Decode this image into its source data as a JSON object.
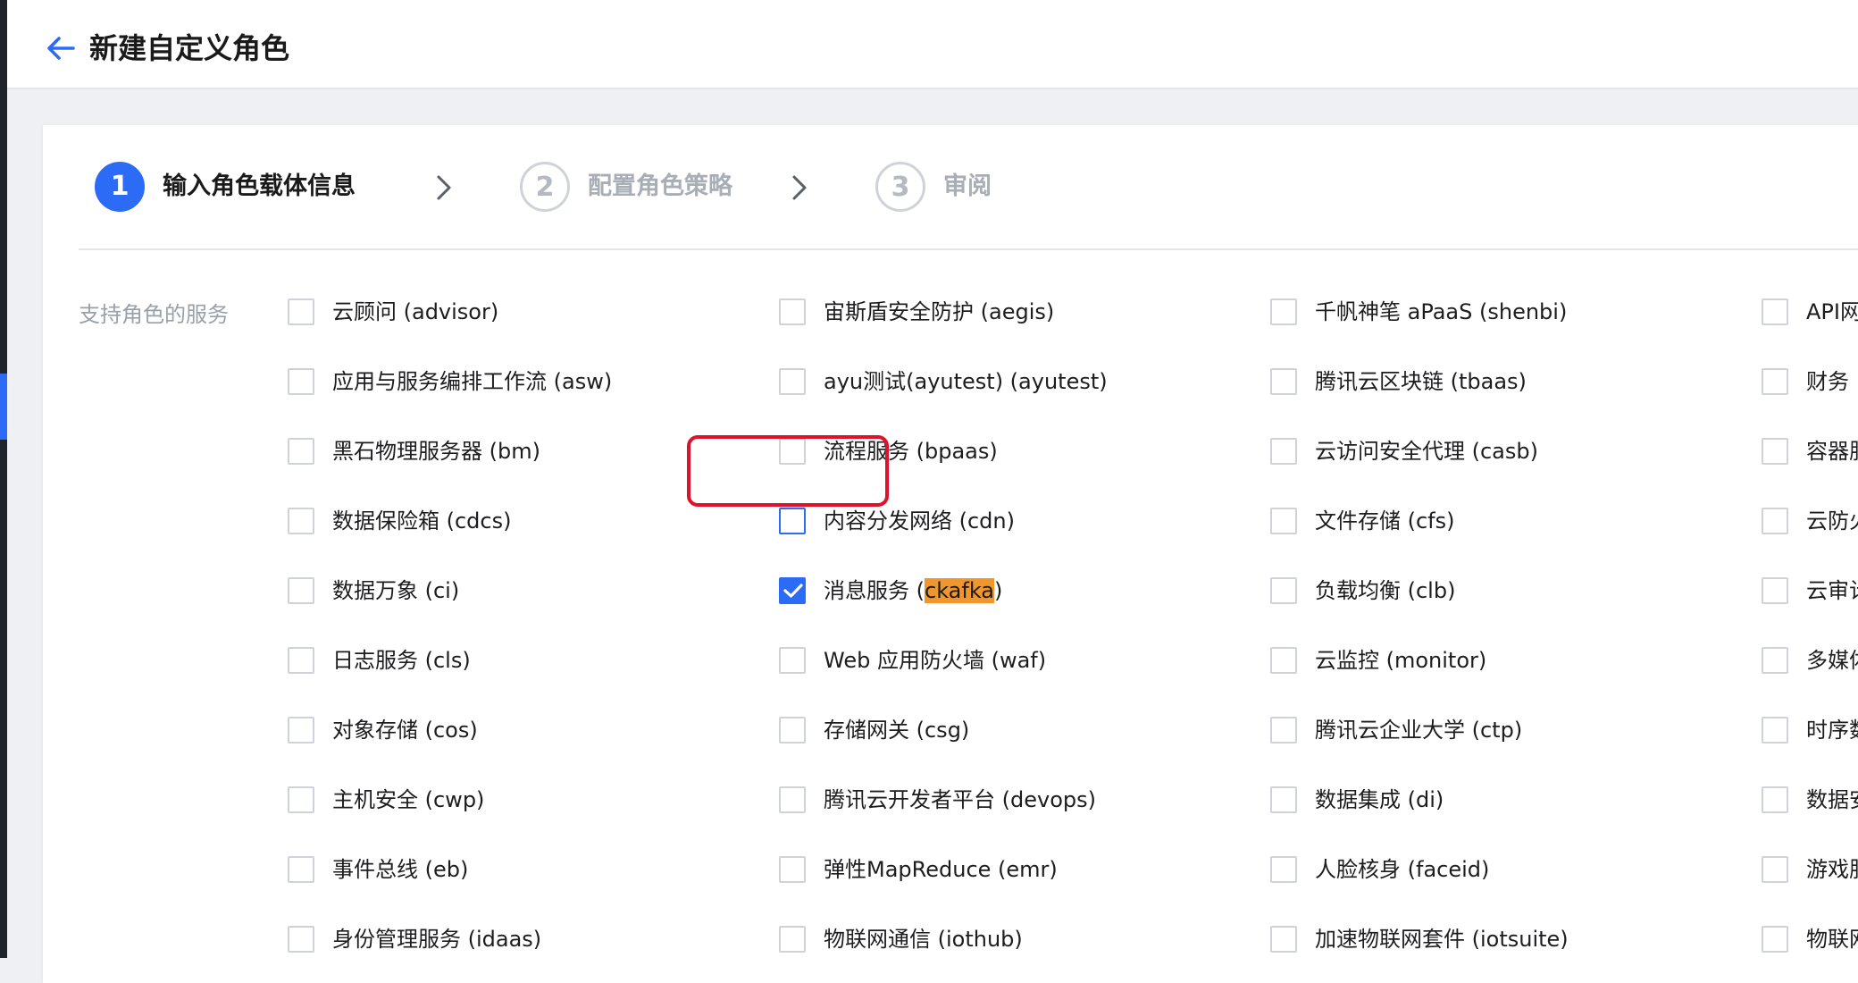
{
  "header": {
    "title": "新建自定义角色"
  },
  "steps": [
    {
      "number": "1",
      "label": "输入角色载体信息",
      "state": "active"
    },
    {
      "number": "2",
      "label": "配置角色策略",
      "state": "inactive"
    },
    {
      "number": "3",
      "label": "审阅",
      "state": "inactive"
    }
  ],
  "section": {
    "label": "支持角色的服务"
  },
  "columns": [
    [
      {
        "label": "云顾问 (advisor)"
      },
      {
        "label": "应用与服务编排工作流 (asw)"
      },
      {
        "label": "黑石物理服务器 (bm)"
      },
      {
        "label": "数据保险箱 (cdcs)"
      },
      {
        "label": "数据万象 (ci)"
      },
      {
        "label": "日志服务 (cls)"
      },
      {
        "label": "对象存储 (cos)"
      },
      {
        "label": "主机安全 (cwp)"
      },
      {
        "label": "事件总线 (eb)"
      },
      {
        "label": "身份管理服务 (idaas)"
      }
    ],
    [
      {
        "label": "宙斯盾安全防护 (aegis)"
      },
      {
        "label": "ayu测试(ayutest) (ayutest)"
      },
      {
        "label": "流程服务 (bpaas)"
      },
      {
        "label": "内容分发网络 (cdn)",
        "hover": true
      },
      {
        "label_before": "消息服务 (",
        "label_highlight": "ckafka",
        "label_after": ")",
        "checked": true
      },
      {
        "label": "Web 应用防火墙 (waf)"
      },
      {
        "label": "存储网关 (csg)"
      },
      {
        "label": "腾讯云开发者平台 (devops)"
      },
      {
        "label": "弹性MapReduce (emr)"
      },
      {
        "label": "物联网通信 (iothub)"
      }
    ],
    [
      {
        "label": "千帆神笔 aPaaS (shenbi)"
      },
      {
        "label": "腾讯云区块链 (tbaas)"
      },
      {
        "label": "云访问安全代理 (casb)"
      },
      {
        "label": "文件存储 (cfs)"
      },
      {
        "label": "负载均衡 (clb)"
      },
      {
        "label": "云监控 (monitor)"
      },
      {
        "label": "腾讯云企业大学 (ctp)"
      },
      {
        "label": "数据集成 (di)"
      },
      {
        "label": "人脸核身 (faceid)"
      },
      {
        "label": "加速物联网套件 (iotsuite)"
      }
    ],
    [
      {
        "label": "API网"
      },
      {
        "label": "财务"
      },
      {
        "label": "容器服"
      },
      {
        "label": "云防火"
      },
      {
        "label": "云审计"
      },
      {
        "label": "多媒体"
      },
      {
        "label": "时序数"
      },
      {
        "label": "数据安"
      },
      {
        "label": "游戏服"
      },
      {
        "label": "物联网"
      }
    ]
  ],
  "colors": {
    "accent": "#2c6bf6",
    "highlight": "#f0962c",
    "annotation": "#e1102b"
  }
}
